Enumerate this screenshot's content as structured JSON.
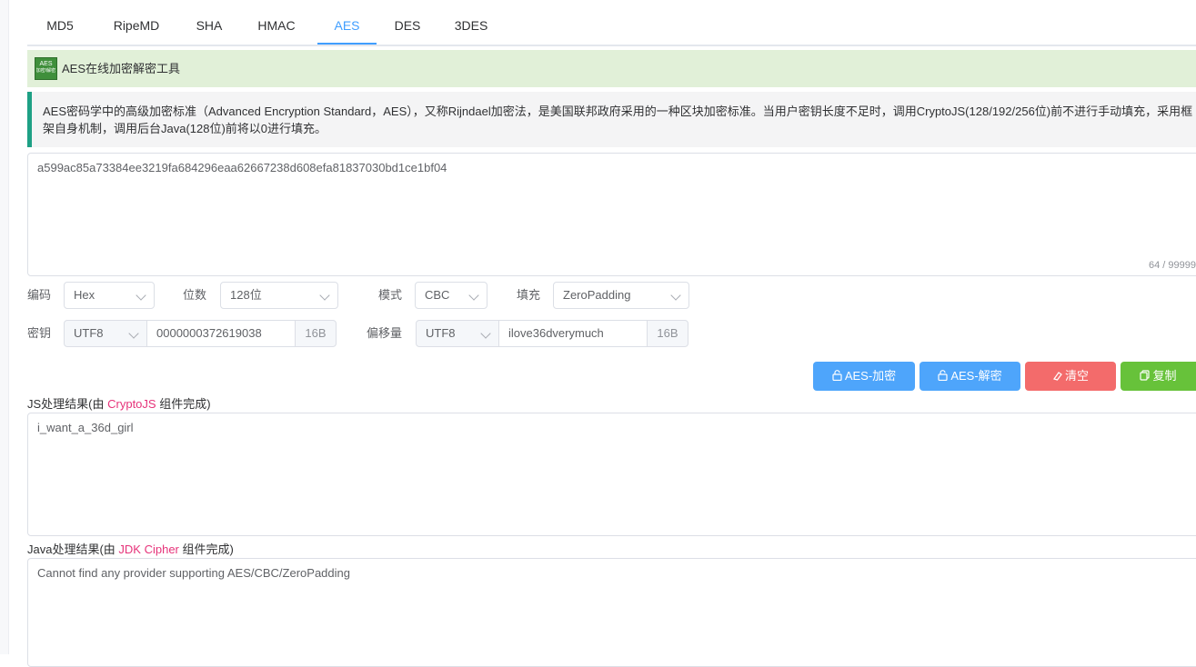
{
  "tabs": [
    {
      "label": "MD5",
      "active": false
    },
    {
      "label": "RipeMD",
      "active": false
    },
    {
      "label": "SHA",
      "active": false
    },
    {
      "label": "HMAC",
      "active": false
    },
    {
      "label": "AES",
      "active": true
    },
    {
      "label": "DES",
      "active": false
    },
    {
      "label": "3DES",
      "active": false
    }
  ],
  "title": {
    "logo_text": "AES",
    "logo_subtext": "加密/解密",
    "text": "AES在线加密解密工具"
  },
  "description": "AES密码学中的高级加密标准（Advanced Encryption Standard，AES），又称Rijndael加密法，是美国联邦政府采用的一种区块加密标准。当用户密钥长度不足时，调用CryptoJS(128/192/256位)前不进行手动填充，采用框架自身机制，调用后台Java(128位)前将以0进行填充。",
  "input": {
    "value": "a599ac85a73384ee3219fa684296eaa62667238d608efa81837030bd1ce1bf04",
    "count": "64 / 99999"
  },
  "options": {
    "encoding_label": "编码",
    "encoding_value": "Hex",
    "bits_label": "位数",
    "bits_value": "128位",
    "mode_label": "模式",
    "mode_value": "CBC",
    "padding_label": "填充",
    "padding_value": "ZeroPadding"
  },
  "key": {
    "label": "密钥",
    "encoding": "UTF8",
    "value": "0000000372619038",
    "size": "16B"
  },
  "iv": {
    "label": "偏移量",
    "encoding": "UTF8",
    "value": "ilove36dverymuch",
    "size": "16B"
  },
  "buttons": {
    "encrypt": "AES-加密",
    "decrypt": "AES-解密",
    "clear": "清空",
    "copy": "复制"
  },
  "js_result": {
    "label_prefix": "JS处理结果(由 ",
    "label_highlight": "CryptoJS",
    "label_suffix": " 组件完成)",
    "value": "i_want_a_36d_girl"
  },
  "java_result": {
    "label_prefix": "Java处理结果(由 ",
    "label_highlight": "JDK Cipher",
    "label_suffix": " 组件完成)",
    "value": "Cannot find any provider supporting AES/CBC/ZeroPadding"
  },
  "colors": {
    "primary": "#409eff",
    "button_blue": "#4ea5fb",
    "button_red": "#f36b6b",
    "button_green": "#67c23a",
    "accent_pink": "#e6337a",
    "desc_border": "#1ea085"
  }
}
